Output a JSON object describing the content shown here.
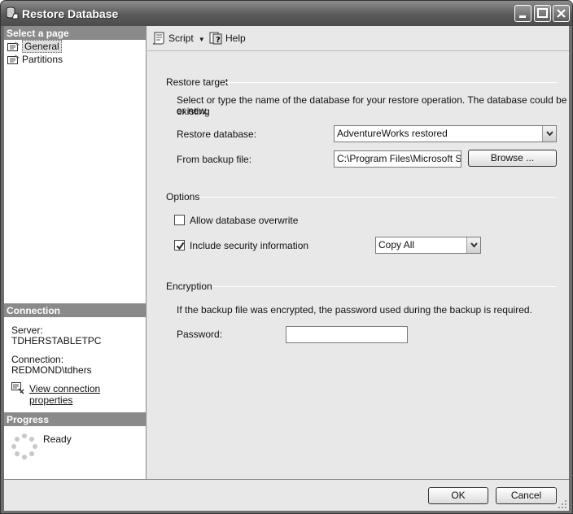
{
  "window": {
    "title": "Restore Database"
  },
  "left": {
    "select_page_header": "Select a page",
    "pages": [
      "General",
      "Partitions"
    ],
    "connection_header": "Connection",
    "server_label": "Server:",
    "server_value": "TDHERSTABLETPC",
    "connection_label": "Connection:",
    "connection_value": "REDMOND\\tdhers",
    "view_props_link": "View connection properties",
    "progress_header": "Progress",
    "progress_status": "Ready"
  },
  "toolbar": {
    "script_label": "Script",
    "help_label": "Help"
  },
  "restore_target": {
    "title": "Restore target",
    "description_line1": "Select or type the name of the database for your restore operation. The database could be existing",
    "description_line2": "or new.",
    "restore_db_label": "Restore database:",
    "restore_db_value": "AdventureWorks restored",
    "from_backup_label": "From backup file:",
    "from_backup_value": "C:\\Program Files\\Microsoft SQL",
    "browse_label": "Browse ..."
  },
  "options": {
    "title": "Options",
    "allow_overwrite_label": "Allow database overwrite",
    "allow_overwrite_checked": false,
    "include_security_label": "Include security information",
    "include_security_checked": true,
    "security_mode_value": "Copy All"
  },
  "encryption": {
    "title": "Encryption",
    "description": "If the backup file was encrypted, the password used during the backup is required.",
    "password_label": "Password:",
    "password_value": ""
  },
  "footer": {
    "ok_label": "OK",
    "cancel_label": "Cancel"
  }
}
